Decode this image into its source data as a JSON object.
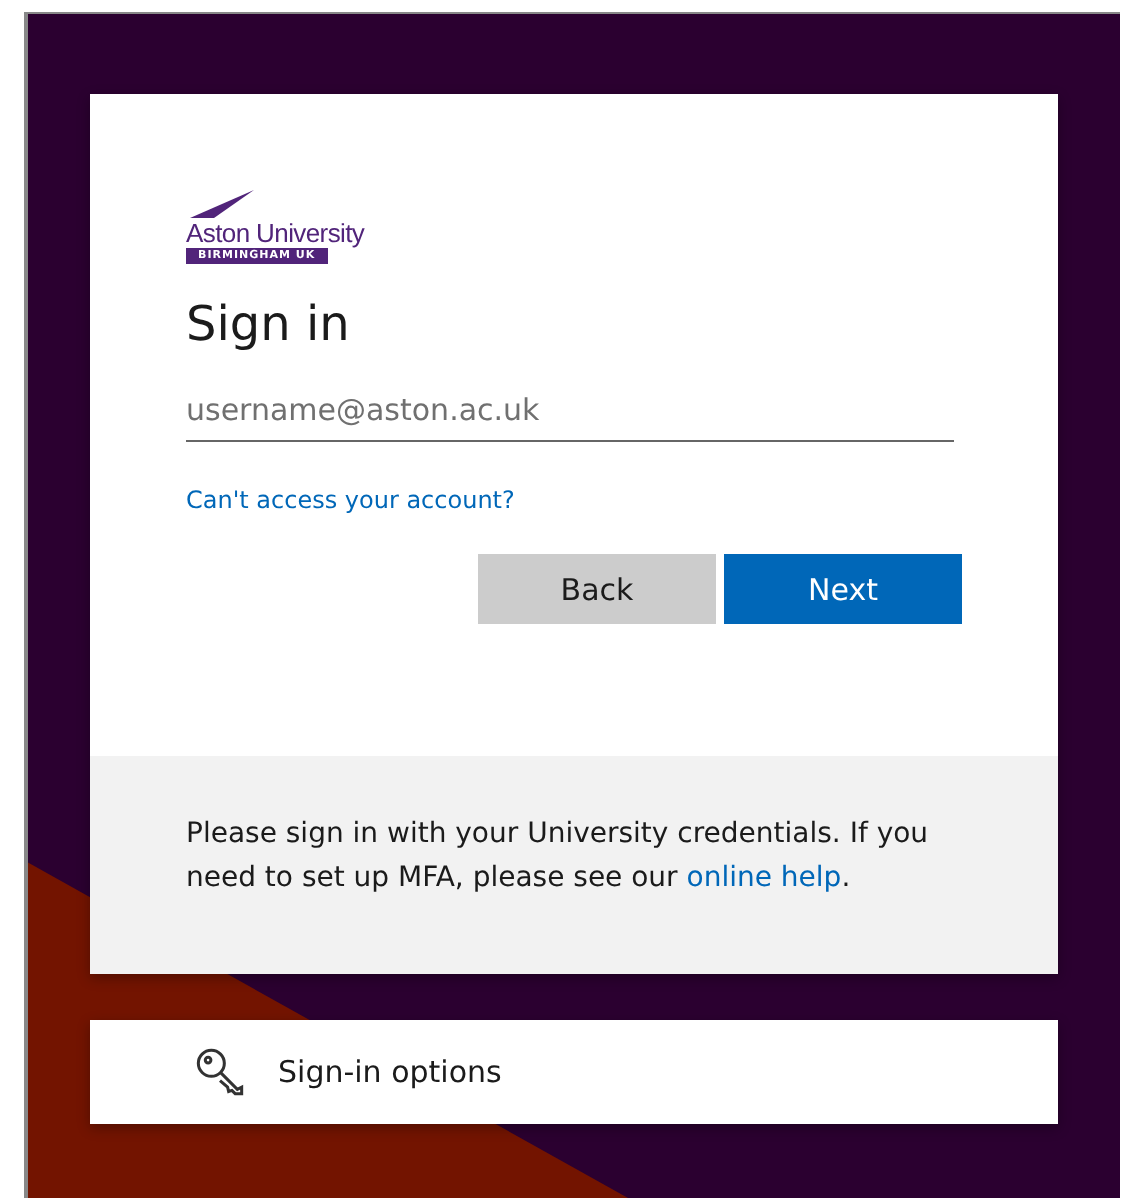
{
  "logo": {
    "name": "Aston University",
    "tagline": "BIRMINGHAM UK"
  },
  "title": "Sign in",
  "username_field": {
    "placeholder": "username@aston.ac.uk"
  },
  "help_link": "Can't access your account?",
  "buttons": [
    {
      "label": "Back",
      "kind": "secondary"
    },
    {
      "label": "Next",
      "kind": "primary"
    }
  ],
  "footer_note": {
    "text": "Please sign in with your University credentials. If you need to set up MFA, please see our ",
    "link": "online help",
    "after": "."
  },
  "sign_in_options": "Sign-in options"
}
